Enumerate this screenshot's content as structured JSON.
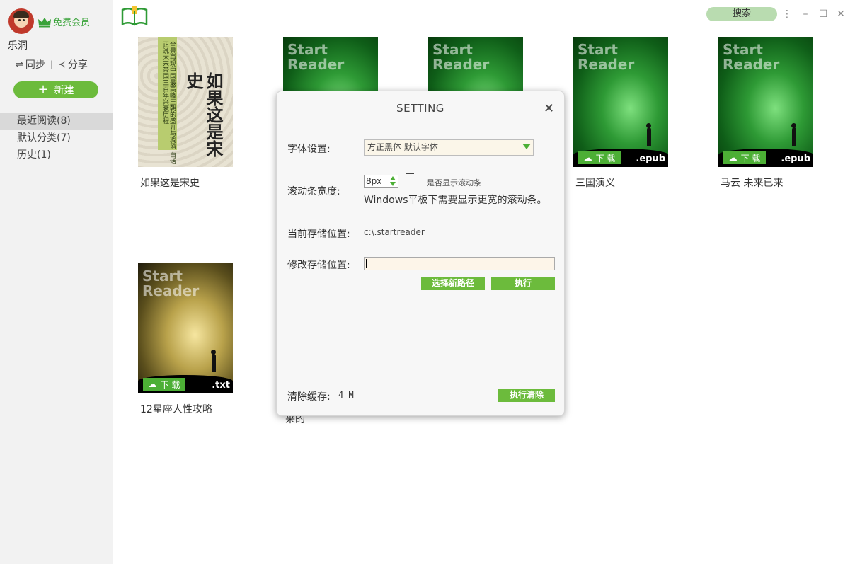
{
  "sidebar": {
    "vip_label": "免费会员",
    "username": "乐洞",
    "sync_label": "同步",
    "share_label": "分享",
    "new_label": "新建",
    "nav": [
      {
        "label": "最近阅读(8)"
      },
      {
        "label": "默认分类(7)"
      },
      {
        "label": "历史(1)"
      }
    ]
  },
  "topbar": {
    "search_label": "搜索"
  },
  "books": [
    {
      "title": "如果这是宋史",
      "cover_text": "全景再现中国最高峰王朝的盛开与凋落 白话正说大宋帝国三百年兴衰历程",
      "cover_title": "如果这是宋史"
    },
    {
      "title": "",
      "brand": "Start Reader"
    },
    {
      "title": "",
      "brand": "Start Reader"
    },
    {
      "title": "三国演义",
      "brand": "Start Reader",
      "badge": "下 载",
      "ext": ".epub"
    },
    {
      "title": "马云 未来已来",
      "brand": "Start Reader",
      "badge": "下 载",
      "ext": ".epub"
    },
    {
      "title": "12星座人性攻略",
      "brand": "Start Reader",
      "badge": "下 载",
      "ext": ".txt"
    },
    {
      "title": "来的"
    }
  ],
  "dialog": {
    "title": "SETTING",
    "font_label": "字体设置:",
    "font_value": "方正黑体   默认字体",
    "scroll_label": "滚动条宽度:",
    "scroll_value": "8px",
    "scroll_checkbox_label": "是否显示滚动条",
    "scroll_hint": "Windows平板下需要显示更宽的滚动条。",
    "current_path_label": "当前存储位置:",
    "current_path_value": "c:\\.startreader",
    "modify_path_label": "修改存储位置:",
    "choose_path_button": "选择新路径",
    "execute_button": "执行",
    "clear_cache_label": "清除缓存:",
    "cache_size": "4 M",
    "clear_cache_button": "执行清除"
  },
  "colors": {
    "accent": "#6cbb3c",
    "badge": "#4caf35",
    "search_bg": "#b9dcb0"
  }
}
